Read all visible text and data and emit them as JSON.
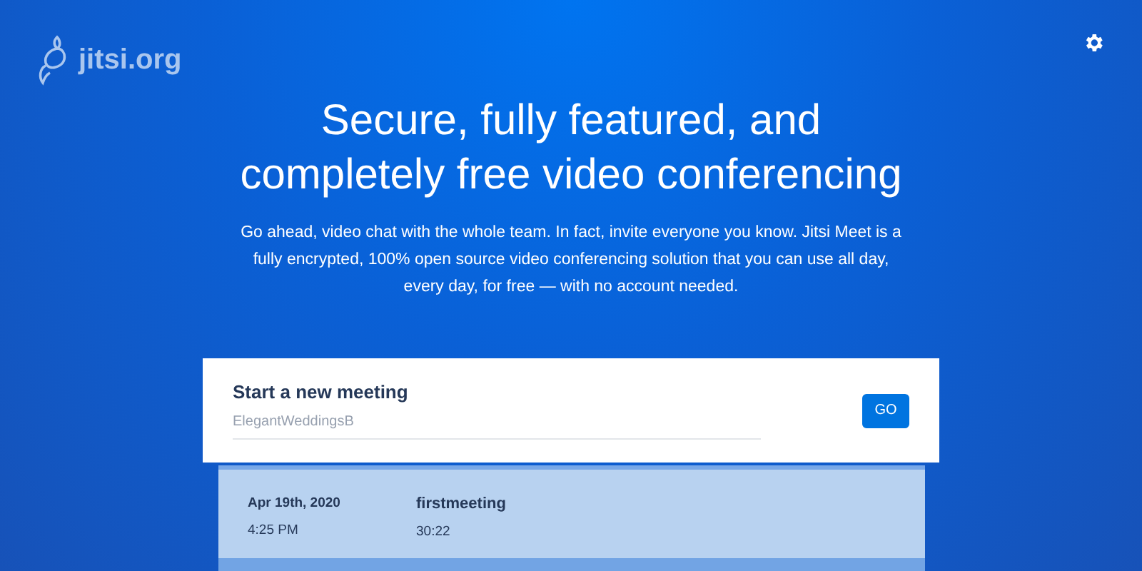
{
  "logo": {
    "text": "jitsi.org"
  },
  "header": {
    "title_lines": [
      "Secure, fully featured, and",
      "completely free video conferencing"
    ],
    "description": "Go ahead, video chat with the whole team. In fact, invite everyone you know. Jitsi Meet is a fully encrypted, 100% open source video conferencing solution that you can use all day, every day, for free — with no account needed."
  },
  "new_meeting": {
    "title": "Start a new meeting",
    "placeholder": "ElegantWeddingsB",
    "button": "GO"
  },
  "recent_meetings": [
    {
      "date": "Apr 19th, 2020",
      "time": "4:25 PM",
      "name": "firstmeeting",
      "duration": "30:22"
    }
  ]
}
